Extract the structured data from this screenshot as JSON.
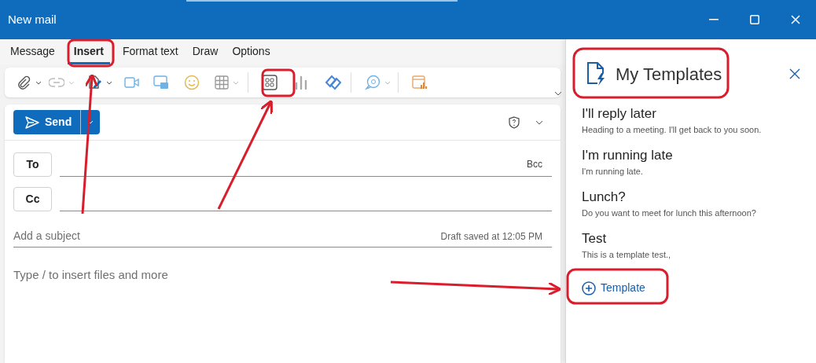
{
  "window": {
    "title": "New mail"
  },
  "tabs": [
    {
      "label": "Message",
      "selected": false
    },
    {
      "label": "Insert",
      "selected": true
    },
    {
      "label": "Format text",
      "selected": false
    },
    {
      "label": "Draw",
      "selected": false
    },
    {
      "label": "Options",
      "selected": false
    }
  ],
  "compose": {
    "send": "Send",
    "to": "To",
    "cc": "Cc",
    "bcc": "Bcc",
    "subject": {
      "placeholder": "Add a subject"
    },
    "draft_status": "Draft saved at 12:05 PM",
    "body": {
      "placeholder": "Type / to insert files and more"
    }
  },
  "templates_panel": {
    "title": "My Templates",
    "items": [
      {
        "title": "I'll reply later",
        "text": "Heading to a meeting. I'll get back to you soon."
      },
      {
        "title": "I'm running late",
        "text": "I'm running late."
      },
      {
        "title": "Lunch?",
        "text": "Do you want to meet for lunch this afternoon?"
      },
      {
        "title": "Test",
        "text": "This is a template test.,"
      }
    ],
    "add_button": "Template"
  }
}
